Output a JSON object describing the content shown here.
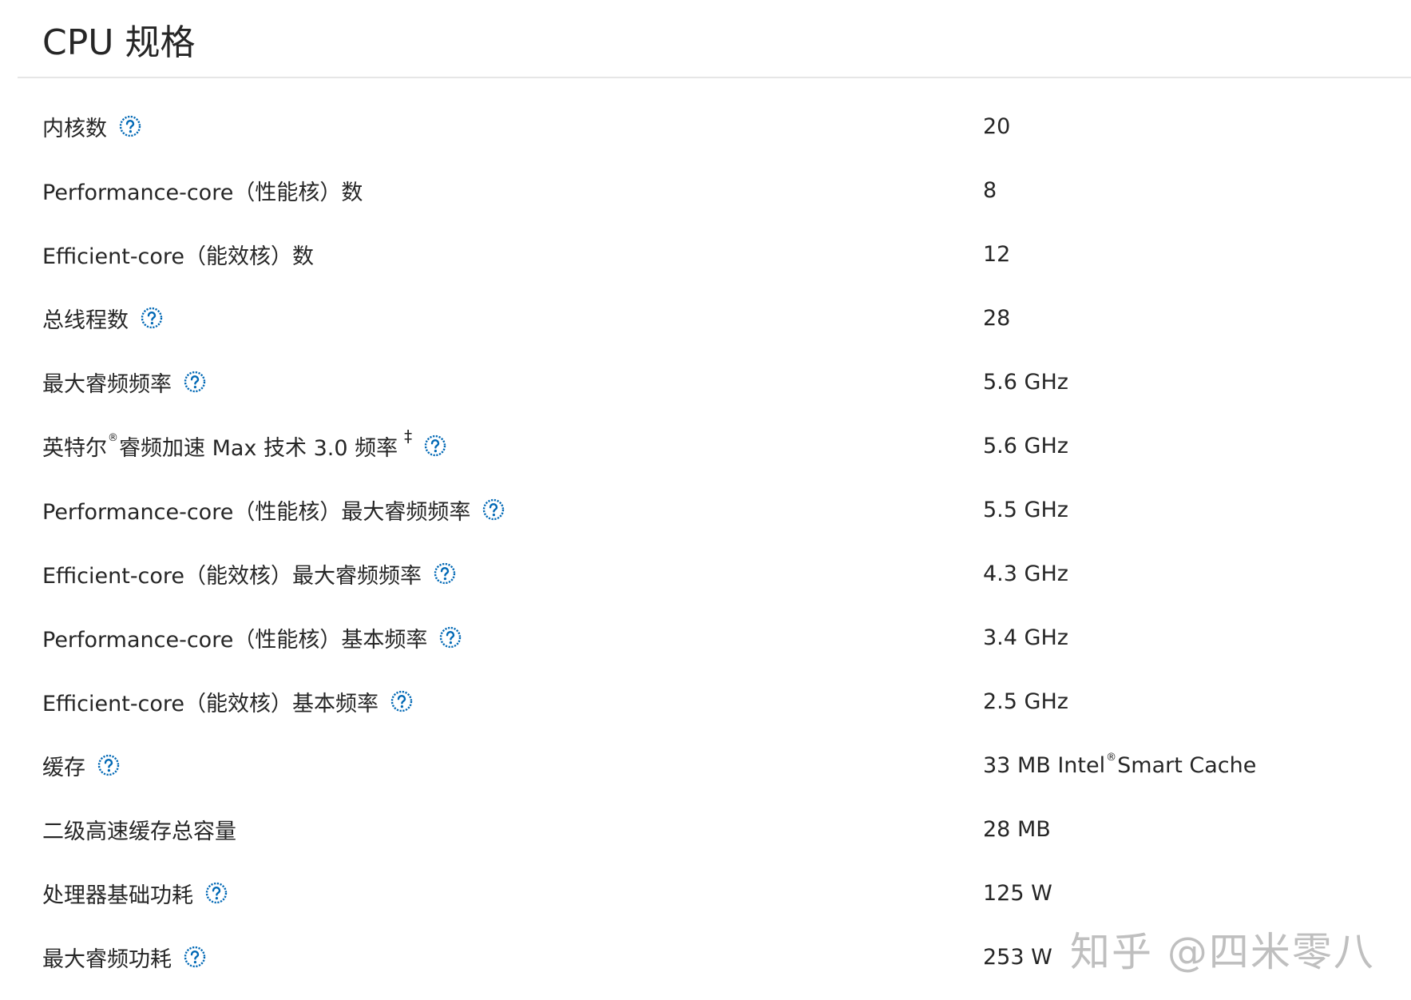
{
  "header": {
    "title": "CPU 规格"
  },
  "specs": [
    {
      "label": "内核数",
      "value": "20",
      "help": true
    },
    {
      "label": "Performance-core（性能核）数",
      "value": "8",
      "help": false
    },
    {
      "label": "Efficient-core（能效核）数",
      "value": "12",
      "help": false
    },
    {
      "label": "总线程数",
      "value": "28",
      "help": true
    },
    {
      "label": "最大睿频频率",
      "value": "5.6 GHz",
      "help": true
    },
    {
      "label_pre": "英特尔",
      "label_reg": "®",
      "label_post": " 睿频加速 Max 技术 3.0 频率",
      "label_mark": "‡",
      "value": "5.6 GHz",
      "help": true
    },
    {
      "label": "Performance-core（性能核）最大睿频频率",
      "value": "5.5 GHz",
      "help": true
    },
    {
      "label": "Efficient-core（能效核）最大睿频频率",
      "value": "4.3 GHz",
      "help": true
    },
    {
      "label": "Performance-core（性能核）基本频率",
      "value": "3.4 GHz",
      "help": true
    },
    {
      "label": "Efficient-core（能效核）基本频率",
      "value": "2.5 GHz",
      "help": true
    },
    {
      "label": "缓存",
      "value_pre": "33 MB Intel",
      "value_reg": "®",
      "value_post": " Smart Cache",
      "help": true
    },
    {
      "label": "二级高速缓存总容量",
      "value": "28 MB",
      "help": false
    },
    {
      "label": "处理器基础功耗",
      "value": "125 W",
      "help": true
    },
    {
      "label": "最大睿频功耗",
      "value": "253 W",
      "help": true
    }
  ],
  "icons": {
    "help": "question-circle-icon"
  },
  "colors": {
    "accent": "#0068b5",
    "text": "#262626",
    "divider": "#e6e6e6"
  },
  "watermark": {
    "text": "知乎 @四米零八"
  }
}
